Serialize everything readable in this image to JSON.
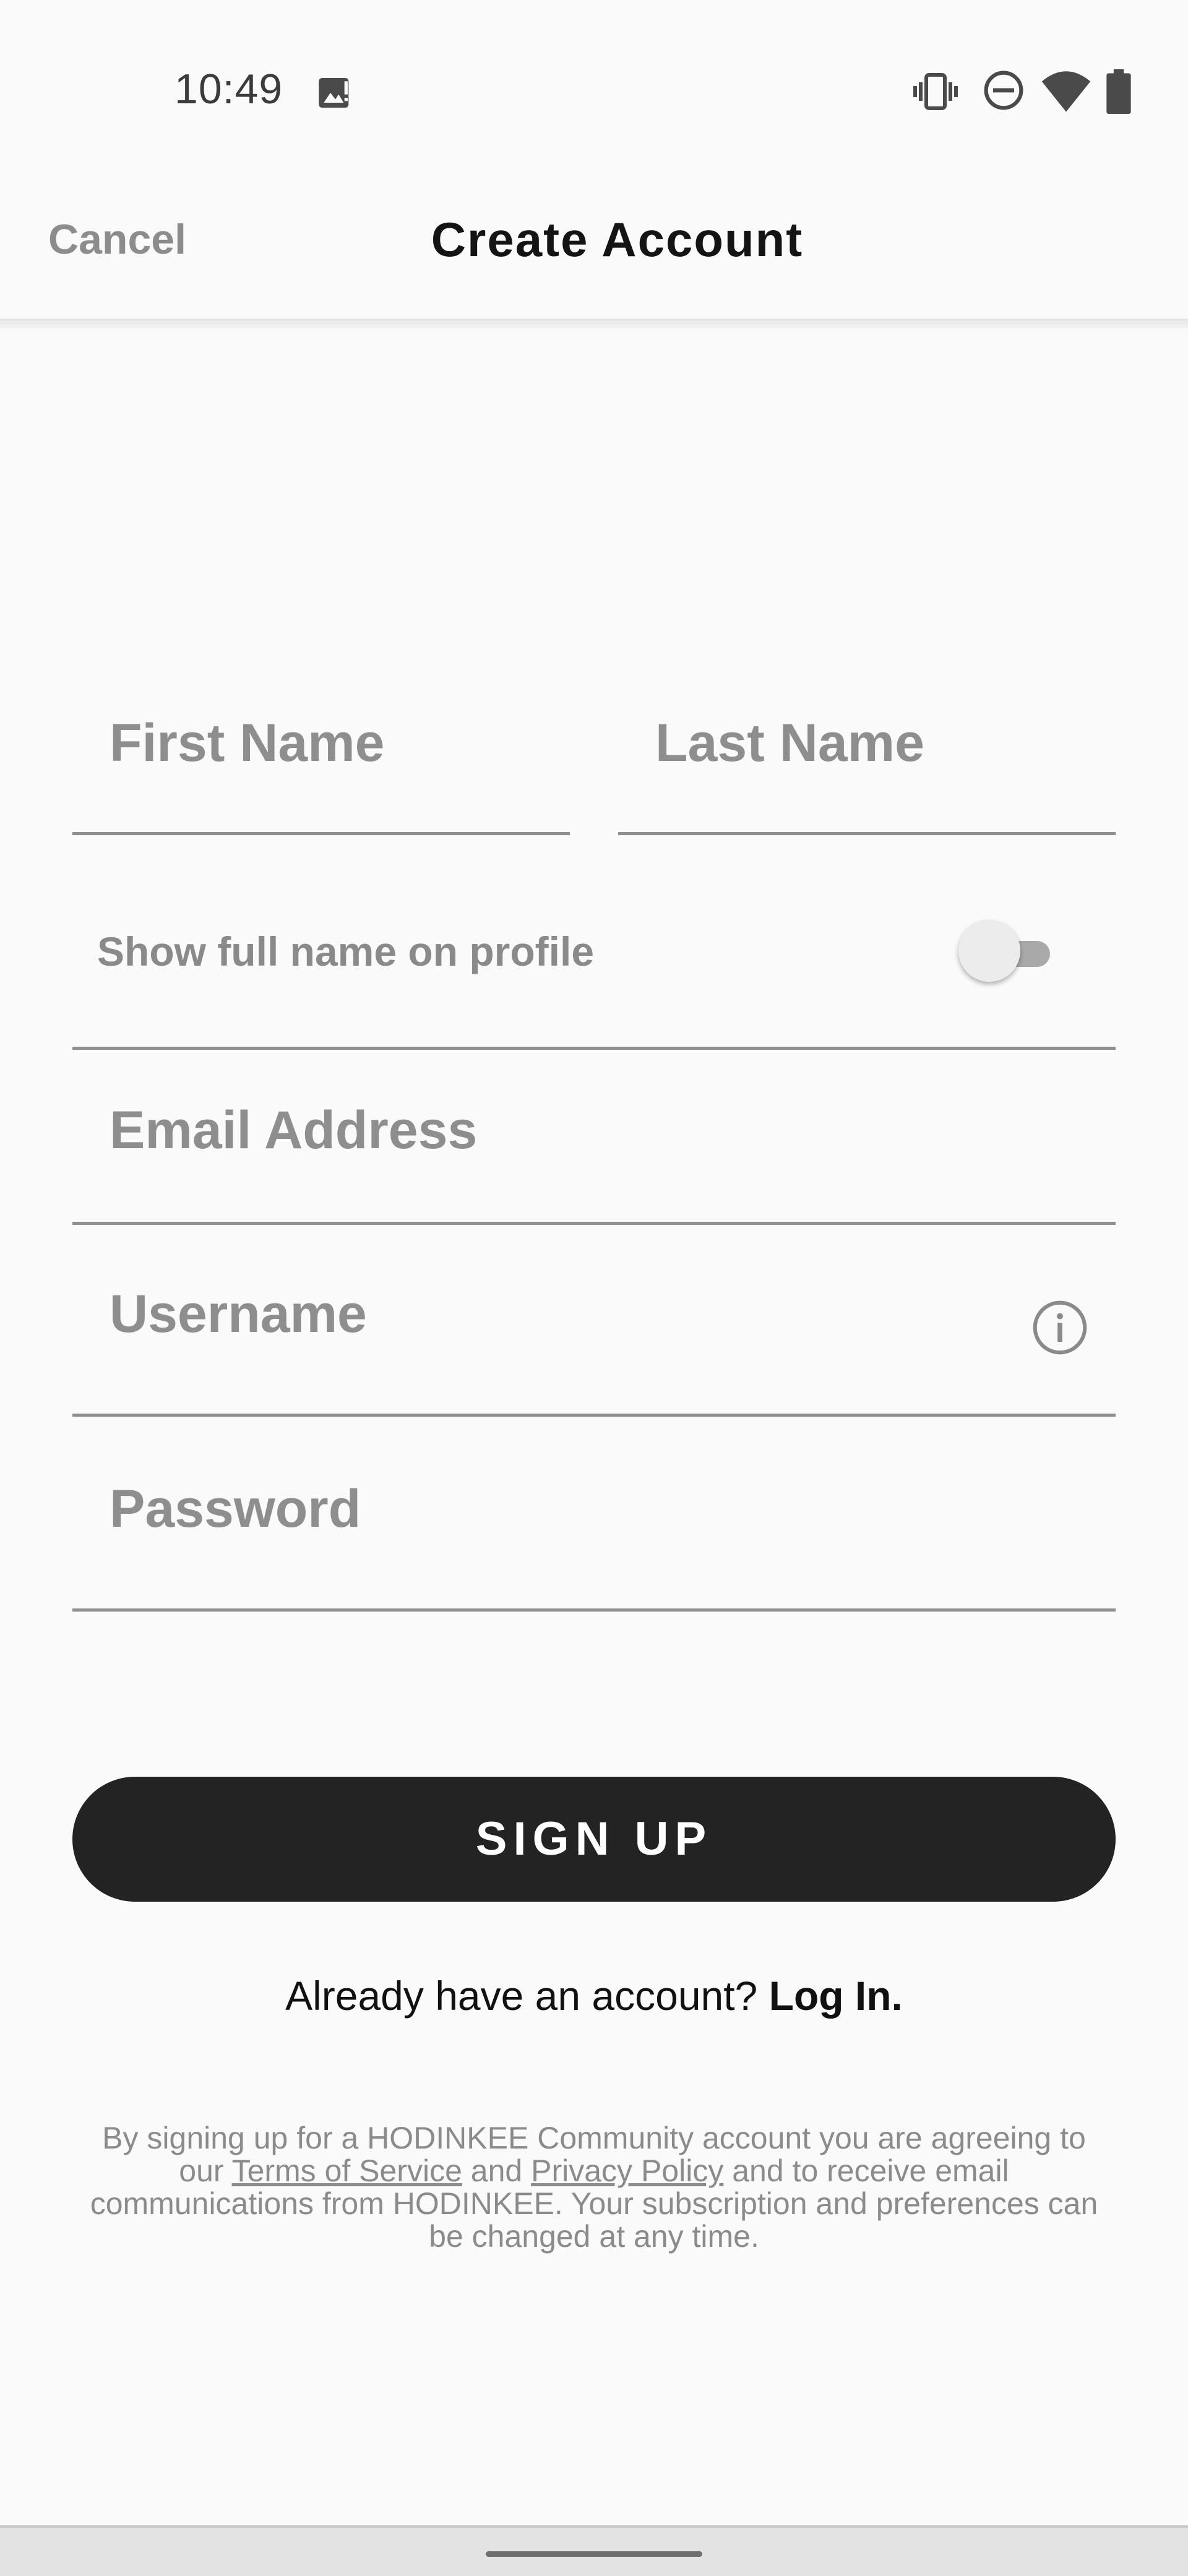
{
  "status_bar": {
    "time": "10:49",
    "icons": [
      "image-notification-icon",
      "vibrate-icon",
      "do-not-disturb-icon",
      "wifi-icon",
      "battery-icon"
    ]
  },
  "header": {
    "cancel_label": "Cancel",
    "title": "Create Account"
  },
  "form": {
    "first_name_placeholder": "First Name",
    "last_name_placeholder": "Last Name",
    "show_full_name_label": "Show full name on profile",
    "show_full_name_enabled": false,
    "email_placeholder": "Email Address",
    "username_placeholder": "Username",
    "username_info_icon": "info-icon",
    "password_placeholder": "Password"
  },
  "signup_button_label": "SIGN UP",
  "login": {
    "prompt": "Already have an account?",
    "link_label": "Log In."
  },
  "legal": {
    "part1": "By signing up for a HODINKEE Community account you are agreeing to our",
    "terms_label": "Terms of Service",
    "and": "and",
    "privacy_label": "Privacy Policy",
    "part2": "and to receive email communications from HODINKEE. Your subscription and preferences can be changed at any time."
  },
  "colors": {
    "button_bg": "#232323",
    "placeholder_text": "#8e8e8e",
    "divider": "#8f8f8f"
  }
}
